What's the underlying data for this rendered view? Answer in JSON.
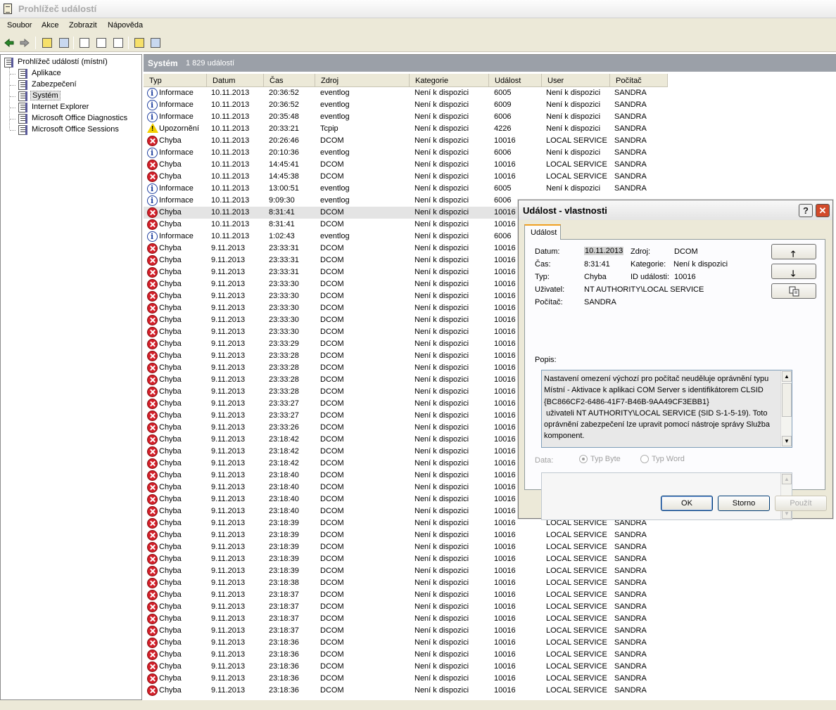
{
  "window": {
    "title": "Prohlížeč událostí"
  },
  "menu": [
    "Soubor",
    "Akce",
    "Zobrazit",
    "Nápověda"
  ],
  "toolbar": {
    "icons": [
      "back-icon",
      "forward-icon",
      "up-folder-icon",
      "show-hide-tree-icon",
      "properties-icon",
      "refresh-icon",
      "export-list-icon",
      "help-icon",
      "console-icon"
    ]
  },
  "tree": {
    "root": "Prohlížeč událostí (místní)",
    "items": [
      "Aplikace",
      "Zabezpečení",
      "Systém",
      "Internet Explorer",
      "Microsoft Office Diagnostics",
      "Microsoft Office Sessions"
    ],
    "selected": "Systém"
  },
  "pane": {
    "title": "Systém",
    "count": "1 829 událostí"
  },
  "columns": [
    "Typ",
    "Datum",
    "Čas",
    "Zdroj",
    "Kategorie",
    "Událost",
    "User",
    "Počítač"
  ],
  "events": [
    [
      "inf",
      "Informace",
      "10.11.2013",
      "20:36:52",
      "eventlog",
      "Není k dispozici",
      "6005",
      "Není k dispozici",
      "SANDRA"
    ],
    [
      "inf",
      "Informace",
      "10.11.2013",
      "20:36:52",
      "eventlog",
      "Není k dispozici",
      "6009",
      "Není k dispozici",
      "SANDRA"
    ],
    [
      "inf",
      "Informace",
      "10.11.2013",
      "20:35:48",
      "eventlog",
      "Není k dispozici",
      "6006",
      "Není k dispozici",
      "SANDRA"
    ],
    [
      "warn",
      "Upozornění",
      "10.11.2013",
      "20:33:21",
      "Tcpip",
      "Není k dispozici",
      "4226",
      "Není k dispozici",
      "SANDRA"
    ],
    [
      "err",
      "Chyba",
      "10.11.2013",
      "20:26:46",
      "DCOM",
      "Není k dispozici",
      "10016",
      "LOCAL SERVICE",
      "SANDRA"
    ],
    [
      "inf",
      "Informace",
      "10.11.2013",
      "20:10:36",
      "eventlog",
      "Není k dispozici",
      "6006",
      "Není k dispozici",
      "SANDRA"
    ],
    [
      "err",
      "Chyba",
      "10.11.2013",
      "14:45:41",
      "DCOM",
      "Není k dispozici",
      "10016",
      "LOCAL SERVICE",
      "SANDRA"
    ],
    [
      "err",
      "Chyba",
      "10.11.2013",
      "14:45:38",
      "DCOM",
      "Není k dispozici",
      "10016",
      "LOCAL SERVICE",
      "SANDRA"
    ],
    [
      "inf",
      "Informace",
      "10.11.2013",
      "13:00:51",
      "eventlog",
      "Není k dispozici",
      "6005",
      "Není k dispozici",
      "SANDRA"
    ],
    [
      "inf",
      "Informace",
      "10.11.2013",
      "9:09:30",
      "eventlog",
      "Není k dispozici",
      "6006",
      "",
      ""
    ],
    [
      "err",
      "Chyba",
      "10.11.2013",
      "8:31:41",
      "DCOM",
      "Není k dispozici",
      "10016",
      "",
      ""
    ],
    [
      "err",
      "Chyba",
      "10.11.2013",
      "8:31:41",
      "DCOM",
      "Není k dispozici",
      "10016",
      "",
      ""
    ],
    [
      "inf",
      "Informace",
      "10.11.2013",
      "1:02:43",
      "eventlog",
      "Není k dispozici",
      "6006",
      "",
      ""
    ],
    [
      "err",
      "Chyba",
      "9.11.2013",
      "23:33:31",
      "DCOM",
      "Není k dispozici",
      "10016",
      "",
      ""
    ],
    [
      "err",
      "Chyba",
      "9.11.2013",
      "23:33:31",
      "DCOM",
      "Není k dispozici",
      "10016",
      "",
      ""
    ],
    [
      "err",
      "Chyba",
      "9.11.2013",
      "23:33:31",
      "DCOM",
      "Není k dispozici",
      "10016",
      "",
      ""
    ],
    [
      "err",
      "Chyba",
      "9.11.2013",
      "23:33:30",
      "DCOM",
      "Není k dispozici",
      "10016",
      "",
      ""
    ],
    [
      "err",
      "Chyba",
      "9.11.2013",
      "23:33:30",
      "DCOM",
      "Není k dispozici",
      "10016",
      "",
      ""
    ],
    [
      "err",
      "Chyba",
      "9.11.2013",
      "23:33:30",
      "DCOM",
      "Není k dispozici",
      "10016",
      "",
      ""
    ],
    [
      "err",
      "Chyba",
      "9.11.2013",
      "23:33:30",
      "DCOM",
      "Není k dispozici",
      "10016",
      "",
      ""
    ],
    [
      "err",
      "Chyba",
      "9.11.2013",
      "23:33:30",
      "DCOM",
      "Není k dispozici",
      "10016",
      "",
      ""
    ],
    [
      "err",
      "Chyba",
      "9.11.2013",
      "23:33:29",
      "DCOM",
      "Není k dispozici",
      "10016",
      "",
      ""
    ],
    [
      "err",
      "Chyba",
      "9.11.2013",
      "23:33:28",
      "DCOM",
      "Není k dispozici",
      "10016",
      "",
      ""
    ],
    [
      "err",
      "Chyba",
      "9.11.2013",
      "23:33:28",
      "DCOM",
      "Není k dispozici",
      "10016",
      "",
      ""
    ],
    [
      "err",
      "Chyba",
      "9.11.2013",
      "23:33:28",
      "DCOM",
      "Není k dispozici",
      "10016",
      "",
      ""
    ],
    [
      "err",
      "Chyba",
      "9.11.2013",
      "23:33:28",
      "DCOM",
      "Není k dispozici",
      "10016",
      "",
      ""
    ],
    [
      "err",
      "Chyba",
      "9.11.2013",
      "23:33:27",
      "DCOM",
      "Není k dispozici",
      "10016",
      "",
      ""
    ],
    [
      "err",
      "Chyba",
      "9.11.2013",
      "23:33:27",
      "DCOM",
      "Není k dispozici",
      "10016",
      "",
      ""
    ],
    [
      "err",
      "Chyba",
      "9.11.2013",
      "23:33:26",
      "DCOM",
      "Není k dispozici",
      "10016",
      "",
      ""
    ],
    [
      "err",
      "Chyba",
      "9.11.2013",
      "23:18:42",
      "DCOM",
      "Není k dispozici",
      "10016",
      "",
      ""
    ],
    [
      "err",
      "Chyba",
      "9.11.2013",
      "23:18:42",
      "DCOM",
      "Není k dispozici",
      "10016",
      "",
      ""
    ],
    [
      "err",
      "Chyba",
      "9.11.2013",
      "23:18:42",
      "DCOM",
      "Není k dispozici",
      "10016",
      "",
      ""
    ],
    [
      "err",
      "Chyba",
      "9.11.2013",
      "23:18:40",
      "DCOM",
      "Není k dispozici",
      "10016",
      "",
      ""
    ],
    [
      "err",
      "Chyba",
      "9.11.2013",
      "23:18:40",
      "DCOM",
      "Není k dispozici",
      "10016",
      "",
      ""
    ],
    [
      "err",
      "Chyba",
      "9.11.2013",
      "23:18:40",
      "DCOM",
      "Není k dispozici",
      "10016",
      "",
      ""
    ],
    [
      "err",
      "Chyba",
      "9.11.2013",
      "23:18:40",
      "DCOM",
      "Není k dispozici",
      "10016",
      "",
      ""
    ],
    [
      "err",
      "Chyba",
      "9.11.2013",
      "23:18:39",
      "DCOM",
      "Není k dispozici",
      "10016",
      "LOCAL SERVICE",
      "SANDRA"
    ],
    [
      "err",
      "Chyba",
      "9.11.2013",
      "23:18:39",
      "DCOM",
      "Není k dispozici",
      "10016",
      "LOCAL SERVICE",
      "SANDRA"
    ],
    [
      "err",
      "Chyba",
      "9.11.2013",
      "23:18:39",
      "DCOM",
      "Není k dispozici",
      "10016",
      "LOCAL SERVICE",
      "SANDRA"
    ],
    [
      "err",
      "Chyba",
      "9.11.2013",
      "23:18:39",
      "DCOM",
      "Není k dispozici",
      "10016",
      "LOCAL SERVICE",
      "SANDRA"
    ],
    [
      "err",
      "Chyba",
      "9.11.2013",
      "23:18:39",
      "DCOM",
      "Není k dispozici",
      "10016",
      "LOCAL SERVICE",
      "SANDRA"
    ],
    [
      "err",
      "Chyba",
      "9.11.2013",
      "23:18:38",
      "DCOM",
      "Není k dispozici",
      "10016",
      "LOCAL SERVICE",
      "SANDRA"
    ],
    [
      "err",
      "Chyba",
      "9.11.2013",
      "23:18:37",
      "DCOM",
      "Není k dispozici",
      "10016",
      "LOCAL SERVICE",
      "SANDRA"
    ],
    [
      "err",
      "Chyba",
      "9.11.2013",
      "23:18:37",
      "DCOM",
      "Není k dispozici",
      "10016",
      "LOCAL SERVICE",
      "SANDRA"
    ],
    [
      "err",
      "Chyba",
      "9.11.2013",
      "23:18:37",
      "DCOM",
      "Není k dispozici",
      "10016",
      "LOCAL SERVICE",
      "SANDRA"
    ],
    [
      "err",
      "Chyba",
      "9.11.2013",
      "23:18:37",
      "DCOM",
      "Není k dispozici",
      "10016",
      "LOCAL SERVICE",
      "SANDRA"
    ],
    [
      "err",
      "Chyba",
      "9.11.2013",
      "23:18:36",
      "DCOM",
      "Není k dispozici",
      "10016",
      "LOCAL SERVICE",
      "SANDRA"
    ],
    [
      "err",
      "Chyba",
      "9.11.2013",
      "23:18:36",
      "DCOM",
      "Není k dispozici",
      "10016",
      "LOCAL SERVICE",
      "SANDRA"
    ],
    [
      "err",
      "Chyba",
      "9.11.2013",
      "23:18:36",
      "DCOM",
      "Není k dispozici",
      "10016",
      "LOCAL SERVICE",
      "SANDRA"
    ],
    [
      "err",
      "Chyba",
      "9.11.2013",
      "23:18:36",
      "DCOM",
      "Není k dispozici",
      "10016",
      "LOCAL SERVICE",
      "SANDRA"
    ],
    [
      "err",
      "Chyba",
      "9.11.2013",
      "23:18:36",
      "DCOM",
      "Není k dispozici",
      "10016",
      "LOCAL SERVICE",
      "SANDRA"
    ]
  ],
  "selected_row": 10,
  "dialog": {
    "title": "Událost - vlastnosti",
    "tab": "Událost",
    "labels": {
      "datum": "Datum:",
      "cas": "Čas:",
      "typ": "Typ:",
      "uzivatel": "Uživatel:",
      "pocitac": "Počítač:",
      "zdroj": "Zdroj:",
      "kategorie": "Kategorie:",
      "id": "ID události:",
      "popis": "Popis:",
      "data": "Data:"
    },
    "values": {
      "datum": "10.11.2013",
      "cas": "8:31:41",
      "typ": "Chyba",
      "uzivatel": "NT AUTHORITY\\LOCAL SERVICE",
      "pocitac": "SANDRA",
      "zdroj": "DCOM",
      "kategorie": "Není k dispozici",
      "id": "10016"
    },
    "description": [
      "Nastavení omezení výchozí pro počítač neuděluje oprávnění typu",
      "Místní - Aktivace k aplikaci COM Server s identifikátorem CLSID",
      "{BC866CF2-6486-41F7-B46B-9AA49CF3EBB1}",
      " uživateli NT AUTHORITY\\LOCAL SERVICE (SID S-1-5-19). Toto",
      "oprávnění zabezpečení lze upravit pomocí nástroje správy Služba",
      "komponent."
    ],
    "radio_byte": "Typ Byte",
    "radio_word": "Typ Word",
    "buttons": {
      "ok": "OK",
      "cancel": "Storno",
      "apply": "Použít"
    },
    "help_glyph": "?",
    "close_glyph": "✕",
    "nav_up_glyph": "🡑",
    "nav_down_glyph": "🡓"
  }
}
